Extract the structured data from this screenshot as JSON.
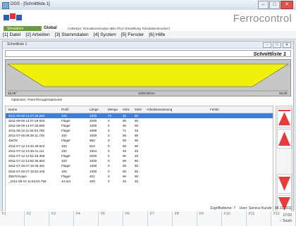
{
  "window": {
    "title": "DGS - [Schnittliste 1]"
  },
  "brand": {
    "name": "Ferrocontrol",
    "sim_label": "Simulation",
    "global": "Global",
    "status": "CoDeSys: Simulationsmodus aktiv (PLC-Einstellung 'Simulationsmodus')"
  },
  "menu": [
    "[1] Datei",
    "[2] Arbeiten",
    "[3] Stammdaten",
    "[4] System",
    "[5] Fenster",
    "[6] Hilfe"
  ],
  "child": {
    "title": "Schnittliste 1",
    "heading": "Schnittliste 1"
  },
  "plot": {
    "left_label": "46,00°",
    "center_label": "1000,00mm",
    "right_label": "46,00°"
  },
  "optimizer": {
    "text": "Optimizer: PassThroughOptimizer"
  },
  "table": {
    "headers": [
      "Name",
      "Profil",
      "Länge",
      "Menge",
      "SW1",
      "SW2",
      "Arbeitsanweisung",
      "Fehler"
    ],
    "rows": [
      [
        "2011-08-09 14:07:26.890",
        "100",
        "1000",
        "74",
        "45",
        "90"
      ],
      [
        "2011-08-09 14:07:29.933",
        "Flügel",
        "2000",
        "0",
        "90",
        "90"
      ],
      [
        "2011-08-09 14:07:33.590",
        "Flügel",
        "1000",
        "0",
        "90",
        "90"
      ],
      [
        "2011-08-10 11:54:53.759",
        "Flügel",
        "1999",
        "0",
        "71",
        "45"
      ],
      [
        "2011-07-05 08:39:11.745",
        "100",
        "1000",
        "0",
        "90",
        "90"
      ],
      [
        "45678",
        "Flügel",
        "950",
        "0",
        "90",
        "90"
      ],
      [
        "2011-07-12 13:42:49.623",
        "100",
        "510",
        "0",
        "90",
        "90"
      ],
      [
        "2011-07-12 13:49:41.111",
        "100",
        "1504",
        "0",
        "45",
        "45"
      ],
      [
        "2011-07-12 13:51:18.358",
        "Flügel",
        "2000",
        "0",
        "90",
        "45"
      ],
      [
        "2011-07-12 13:52:36.863",
        "100",
        "1000",
        "0",
        "90",
        "90"
      ],
      [
        "2011-07-26 07:15:45.491",
        "Flügel",
        "1000",
        "0",
        "90",
        "90"
      ],
      [
        "2011-07-26 07:15:52.445",
        "100",
        "1000",
        "0",
        "90",
        "90"
      ],
      [
        "45678 Kopie",
        "Flügel",
        "201",
        "0",
        "90",
        "90"
      ],
      [
        "_2011-08-10 11:54:53.759",
        "44-ant",
        "200",
        "0",
        "45",
        "45"
      ]
    ]
  },
  "statusbar": {
    "level": "Zugriffsebene: 7",
    "user": "User: Service Kunde",
    "date": "08.11.2011",
    "time": "17:02",
    "touch": "Touch"
  },
  "fkeys": [
    "F1",
    "F2",
    "F3",
    "F4",
    "F5",
    "F6",
    "F7",
    "F8",
    "F9",
    "F10",
    "F11",
    "F12"
  ],
  "colors": {
    "arrow": "#e43b3b",
    "yellow": "#f1f00c",
    "selection": "#3d7fd1"
  }
}
